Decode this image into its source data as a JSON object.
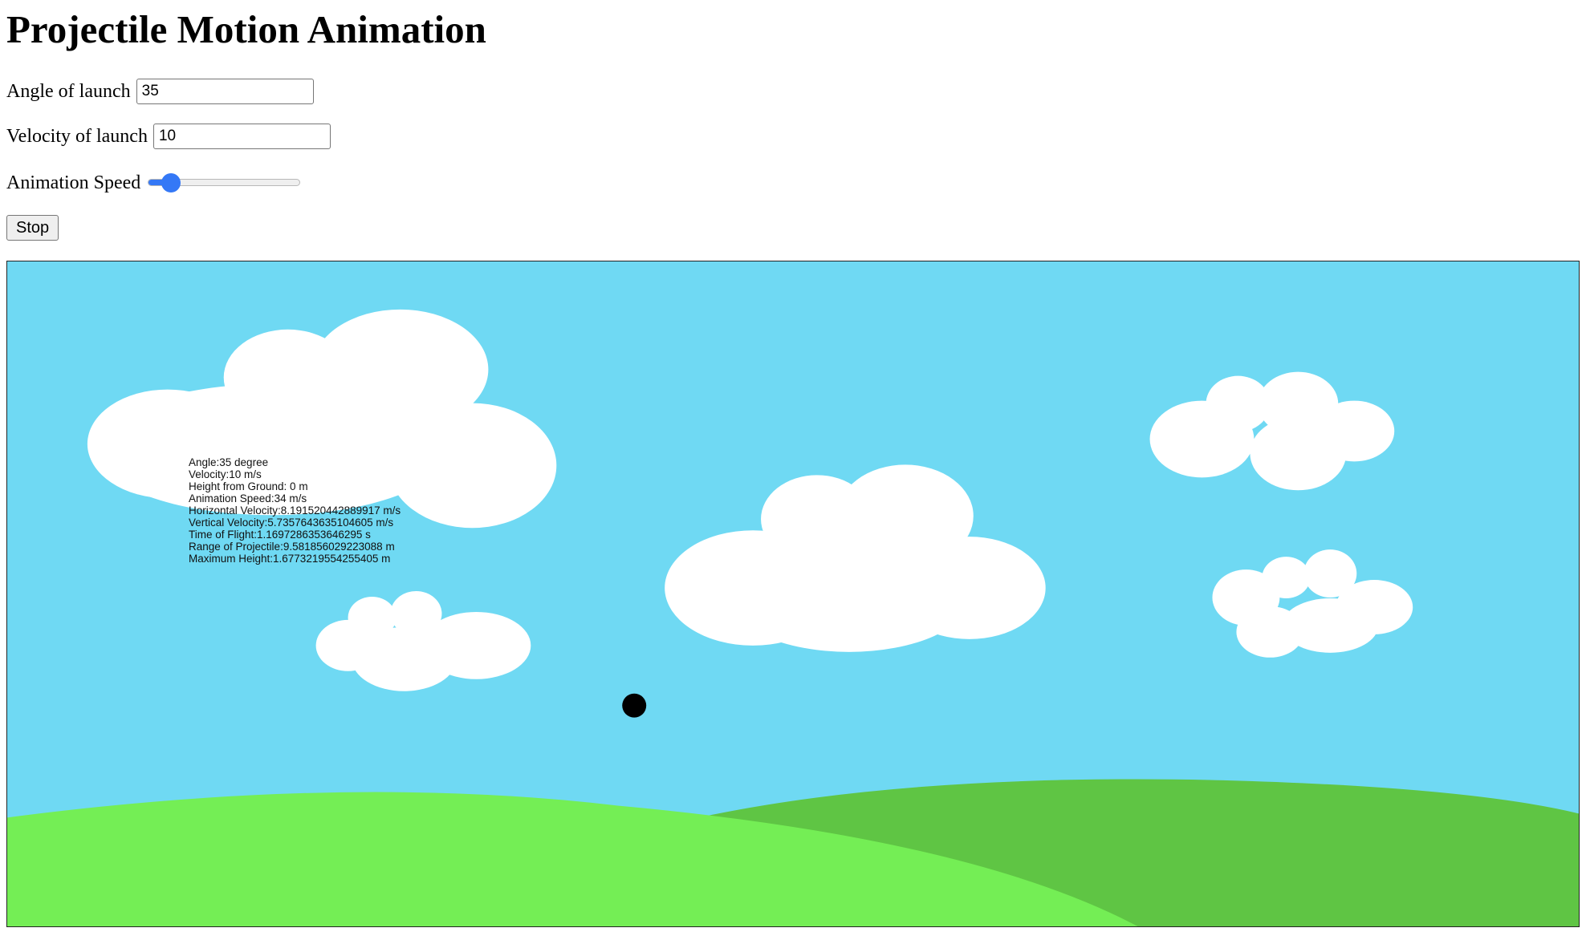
{
  "page": {
    "title": "Projectile Motion Animation"
  },
  "controls": {
    "angle_label": "Angle of launch",
    "angle_value": "35",
    "velocity_label": "Velocity of launch",
    "velocity_value": "10",
    "speed_label": "Animation Speed",
    "speed_fraction": 0.1,
    "stop_label": "Stop"
  },
  "scene": {
    "colors": {
      "sky": "#6fd9f3",
      "cloud": "#ffffff",
      "hill_front": "#74ee55",
      "hill_back": "#5fc544",
      "projectile": "#000000"
    }
  },
  "stats": {
    "angle": "Angle:35 degree",
    "velocity": "Velocity:10 m/s",
    "height": "Height from Ground: 0 m",
    "animation_speed": "Animation Speed:34 m/s",
    "horizontal_velocity": "Horizontal Velocity:8.191520442889917 m/s",
    "vertical_velocity": "Vertical Velocity:5.735764363510460​5 m/s",
    "time_of_flight": "Time of Flight:1.1697286353646295 s",
    "range": "Range of Projectile:9.581856029223088 m",
    "max_height": "Maximum Height:1.6773219554255405 m"
  }
}
